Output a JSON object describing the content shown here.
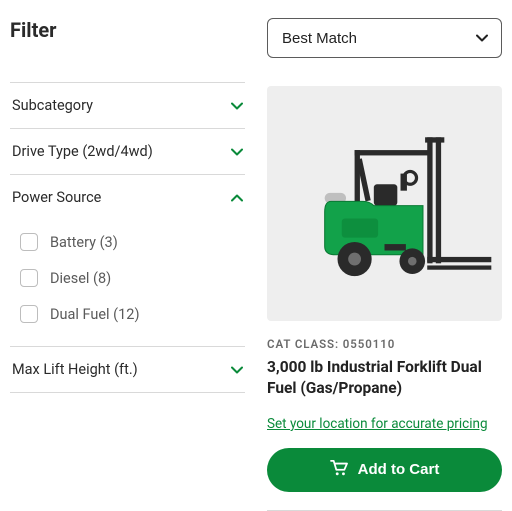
{
  "filter": {
    "title": "Filter",
    "facets": [
      {
        "label": "Subcategory",
        "expanded": false
      },
      {
        "label": "Drive Type (2wd/4wd)",
        "expanded": false
      },
      {
        "label": "Power Source",
        "expanded": true,
        "options": [
          {
            "label": "Battery (3)"
          },
          {
            "label": "Diesel (8)"
          },
          {
            "label": "Dual Fuel (12)"
          }
        ]
      },
      {
        "label": "Max Lift Height (ft.)",
        "expanded": false
      }
    ]
  },
  "sort": {
    "selected": "Best Match"
  },
  "product": {
    "cat_class_label": "CAT CLASS: 0550110",
    "title": "3,000 lb Industrial Forklift Dual Fuel (Gas/Propane)",
    "location_link": "Set your location for accurate pricing",
    "add_to_cart": "Add to Cart"
  },
  "colors": {
    "accent": "#0a8a3a"
  }
}
